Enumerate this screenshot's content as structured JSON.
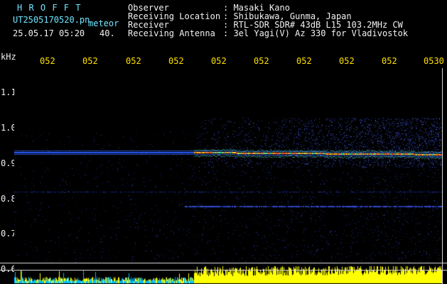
{
  "header": {
    "app_name": "H R O F F T",
    "filename": "UT2505170520.pn",
    "mode": "meteor",
    "datetime": "25.05.17 05:20",
    "count": "40.",
    "info_labels": [
      "Observer",
      "Receiving Location",
      "Receiver",
      "Receiving Antenna"
    ],
    "info_values": [
      ": Masaki Kano",
      ": Shibukawa, Gunma, Japan",
      ": RTL-SDR SDR# 43dB L15 103.2MHz CW",
      ": 3el Yagi(V) Az 330 for Vladivostok"
    ]
  },
  "time_axis": {
    "labels": [
      "052",
      "052",
      "052",
      "052",
      "052",
      "052",
      "052",
      "052",
      "052",
      "0530"
    ]
  },
  "freq_axis": {
    "unit": "kHz",
    "labels": [
      "1.1",
      "1.0",
      "0.9",
      "0.8",
      "0.7",
      "0.6"
    ]
  },
  "colors": {
    "background": "#000000",
    "header_cyan": "#6fe6ff",
    "time_labels": "#ffe000",
    "signal_blue": "#2048ff",
    "signal_hot": "#ff3020",
    "spectrum_yellow": "#ffff00",
    "spectrum_cyan": "#00c8ff"
  }
}
